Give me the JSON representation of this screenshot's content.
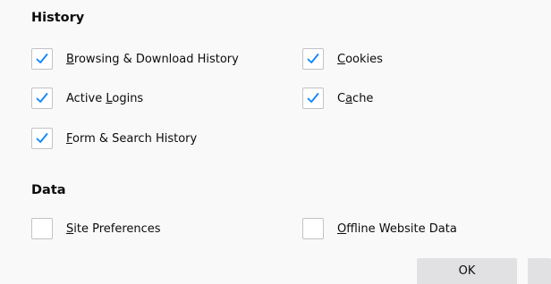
{
  "history": {
    "title": "History",
    "options": {
      "browsing": {
        "label": "Browsing & Download History",
        "accesskey": "B",
        "rest": "rowsing & Download History",
        "checked": true
      },
      "logins": {
        "label_pre": "Active ",
        "accesskey": "L",
        "rest": "ogins",
        "checked": true
      },
      "form": {
        "accesskey": "F",
        "rest": "orm & Search History",
        "checked": true
      },
      "cookies": {
        "accesskey": "C",
        "rest": "ookies",
        "checked": true
      },
      "cache": {
        "label_pre": "C",
        "accesskey": "a",
        "rest": "che",
        "checked": true
      }
    }
  },
  "data": {
    "title": "Data",
    "options": {
      "site_prefs": {
        "accesskey": "S",
        "rest": "ite Preferences",
        "checked": false
      },
      "offline": {
        "accesskey": "O",
        "rest": "ffline Website Data",
        "checked": false
      }
    }
  },
  "buttons": {
    "ok_label": "OK",
    "cancel_label": ""
  },
  "colors": {
    "background": "#f9f9fa",
    "checkmark": "#0a84ff",
    "checkbox_border": "#c2c2c6",
    "button_bg": "#e1e1e3"
  }
}
